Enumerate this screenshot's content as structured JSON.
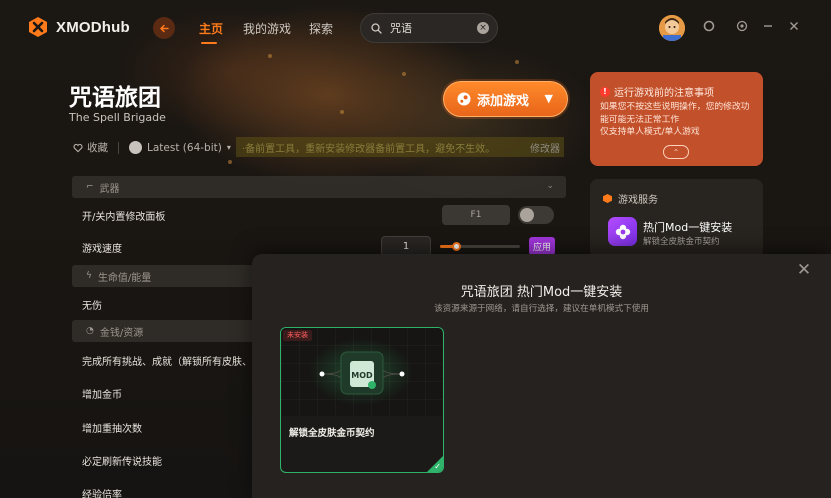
{
  "app": {
    "name": "XMODhub",
    "brand_color": "#ff7a1a"
  },
  "nav": {
    "back_icon": "arrow-left-icon",
    "items": [
      {
        "label": "主页",
        "active": true
      },
      {
        "label": "我的游戏",
        "active": false
      },
      {
        "label": "探索",
        "active": false
      }
    ]
  },
  "search": {
    "value": "咒语",
    "icon": "search-icon"
  },
  "window_controls": [
    "theme-icon",
    "settings-icon",
    "minimize-icon",
    "close-icon"
  ],
  "game": {
    "title": "咒语旅团",
    "subtitle": "The Spell Brigade",
    "favorite_label": "收藏",
    "version_label": "Latest (64-bit)",
    "notice_text": "·备前置工具，重新安装修改器备前置工具，避免不生效。",
    "notice_link": "修改器",
    "add_button_label": "添加游戏"
  },
  "warning": {
    "title": "运行游戏前的注意事项",
    "lines": [
      "如果您不按这些说明操作，您的修改功能可能无法正常工作",
      "仅支持单人模式/单人游戏"
    ],
    "color": "#c2502a"
  },
  "services": {
    "heading": "游戏服务",
    "item_name": "热门Mod一键安装",
    "item_desc": "解锁全皮肤金币契约"
  },
  "trainer": {
    "sections": {
      "weapons": "武器",
      "health": "生命值/能量",
      "money": "金钱/资源"
    },
    "rows": {
      "toggle_panel": "开/关内置修改面板",
      "toggle_key": "F1",
      "game_speed": "游戏速度",
      "game_speed_value": "1",
      "game_speed_slider": 0.2,
      "apply": "应用",
      "invincible": "无伤",
      "complete_all": "完成所有挑战、成就（解锁所有皮肤、角",
      "add_gold": "增加金币",
      "add_draws": "增加重抽次数",
      "refresh_legendary": "必定刷新传说技能",
      "xp_multiplier": "经验倍率"
    }
  },
  "modal": {
    "title": "咒语旅团 热门Mod一键安装",
    "subtitle": "该资源来源于网络，请自行选择，建议在单机模式下使用",
    "card": {
      "badge": "未安装",
      "name": "解锁全皮肤金币契约",
      "accent": "#2fb36a"
    }
  }
}
